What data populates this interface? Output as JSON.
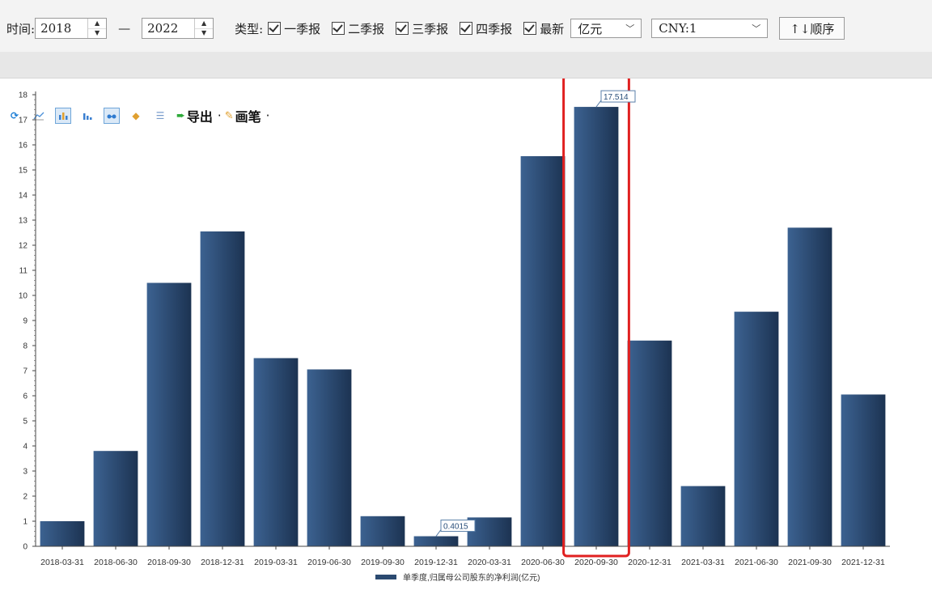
{
  "filters": {
    "time_label": "时间:",
    "year_from": "2018",
    "year_separator": "—",
    "year_to": "2022",
    "type_label": "类型:",
    "checkboxes": [
      {
        "label": "一季报",
        "checked": true
      },
      {
        "label": "二季报",
        "checked": true
      },
      {
        "label": "三季报",
        "checked": true
      },
      {
        "label": "四季报",
        "checked": true
      },
      {
        "label": "最新",
        "checked": true
      }
    ],
    "unit_select": "亿元",
    "currency_select": "CNY:1",
    "sort_button": "↑↓顺序"
  },
  "toolbar": {
    "export_label": "导出",
    "pen_label": "画笔",
    "dropdown_mark": "·"
  },
  "chart_data": {
    "type": "bar",
    "categories": [
      "2018-03-31",
      "2018-06-30",
      "2018-09-30",
      "2018-12-31",
      "2019-03-31",
      "2019-06-30",
      "2019-09-30",
      "2019-12-31",
      "2020-03-31",
      "2020-06-30",
      "2020-09-30",
      "2020-12-31",
      "2021-03-31",
      "2021-06-30",
      "2021-09-30",
      "2021-12-31"
    ],
    "series": [
      {
        "name": "单季度,归属母公司股东的净利润(亿元)",
        "values": [
          1.0,
          3.8,
          10.5,
          12.55,
          7.5,
          7.05,
          1.2,
          0.4015,
          1.15,
          15.55,
          17.514,
          8.2,
          2.4,
          9.35,
          12.7,
          6.05
        ]
      }
    ],
    "ylim": [
      0,
      18
    ],
    "yticks": [
      "0",
      "1",
      "2",
      "3",
      "4",
      "5",
      "6",
      "7",
      "8",
      "9",
      "10",
      "11",
      "12",
      "13",
      "14",
      "15",
      "16",
      "17",
      "18"
    ],
    "data_labels": [
      {
        "category": "2019-12-31",
        "text": "0.4015"
      },
      {
        "category": "2020-09-30",
        "text": "17.514"
      }
    ],
    "highlight_category": "2020-09-30",
    "bar_color": "#2b4a70",
    "highlight_box_color": "#e02020",
    "legend_position": "bottom-center",
    "xlabel": "",
    "ylabel": ""
  }
}
